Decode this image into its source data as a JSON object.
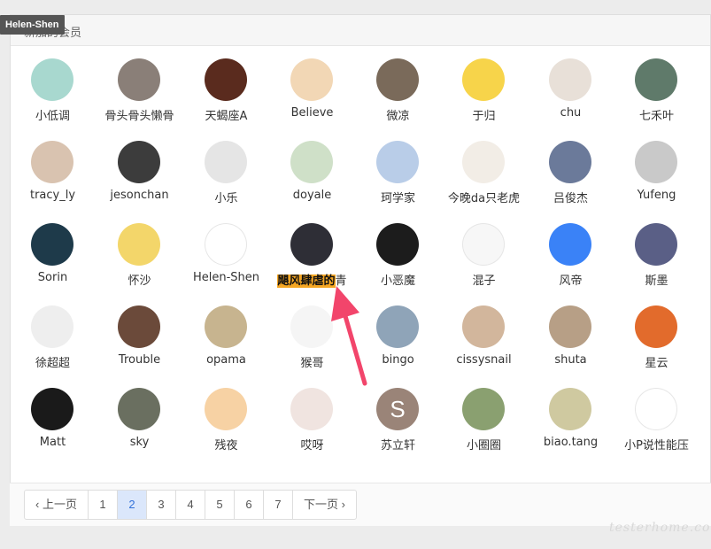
{
  "tooltip": {
    "text": "Helen-Shen"
  },
  "panel": {
    "title": "新加的会员"
  },
  "members": [
    {
      "name": "小低调"
    },
    {
      "name": "骨头骨头懒骨"
    },
    {
      "name": "天蝎座A"
    },
    {
      "name": "Believe"
    },
    {
      "name": "微凉"
    },
    {
      "name": "于归"
    },
    {
      "name": "chu"
    },
    {
      "name": "七禾叶"
    },
    {
      "name": "tracy_ly"
    },
    {
      "name": "jesonchan"
    },
    {
      "name": "小乐"
    },
    {
      "name": "doyale"
    },
    {
      "name": "珂学家"
    },
    {
      "name": "今晚da只老虎"
    },
    {
      "name": "吕俊杰"
    },
    {
      "name": "Yufeng"
    },
    {
      "name": "Sorin"
    },
    {
      "name": "怀沙"
    },
    {
      "name": "Helen-Shen"
    },
    {
      "name": "飓风肆虐的青",
      "highlight": "飓风肆虐的",
      "rest": "青"
    },
    {
      "name": "小恶魔"
    },
    {
      "name": "混子"
    },
    {
      "name": "风帝"
    },
    {
      "name": "斯墨"
    },
    {
      "name": "徐超超"
    },
    {
      "name": "Trouble"
    },
    {
      "name": "opama"
    },
    {
      "name": "猴哥"
    },
    {
      "name": "bingo"
    },
    {
      "name": "cissysnail"
    },
    {
      "name": "shuta"
    },
    {
      "name": "星云"
    },
    {
      "name": "Matt"
    },
    {
      "name": "sky"
    },
    {
      "name": "残夜"
    },
    {
      "name": "哎呀"
    },
    {
      "name": "苏立轩",
      "letter": "S"
    },
    {
      "name": "小圈圈"
    },
    {
      "name": "biao.tang"
    },
    {
      "name": "小P说性能压"
    }
  ],
  "avatar_colors": [
    "#a8d8cf",
    "#8a7f78",
    "#5a2b1e",
    "#f2d7b5",
    "#7a6a5a",
    "#f7d44a",
    "#e8e0d8",
    "#5f7a6a",
    "#d9c3b0",
    "#3c3c3c",
    "#e5e5e5",
    "#cfe0c8",
    "#b9cde8",
    "#f2ede6",
    "#6b7a9a",
    "#c9c9c9",
    "#1e3a4a",
    "#f3d66a",
    "#ffffff",
    "#2e2e36",
    "#1c1c1c",
    "#f7f7f7",
    "#3a82f7",
    "#5a5f86",
    "#eeeeee",
    "#6b4a3a",
    "#c7b48f",
    "#f5f5f5",
    "#8fa4b8",
    "#d2b69c",
    "#b79f86",
    "#e26b2c",
    "#1a1a1a",
    "#6a6f60",
    "#f7d2a4",
    "#f0e4e0",
    "#9a8478",
    "#8aa070",
    "#cfc9a0",
    "#ffffff"
  ],
  "pagination": {
    "prev": "‹ 上一页",
    "pages": [
      "1",
      "2",
      "3",
      "4",
      "5",
      "6",
      "7"
    ],
    "active_page": "2",
    "next": "下一页 ›"
  },
  "watermark": "testerhome.com"
}
